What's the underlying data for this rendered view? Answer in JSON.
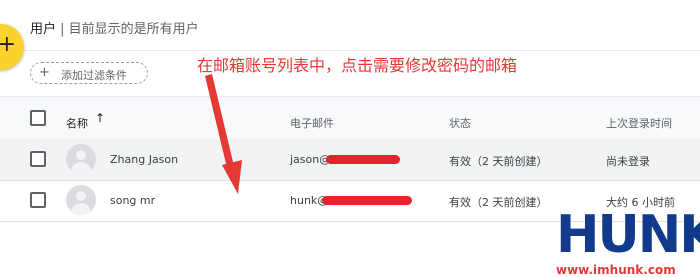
{
  "header": {
    "title": "用户",
    "subtitle": "| 目前显示的是所有用户",
    "fab_symbol": "+"
  },
  "filter": {
    "label": "添加过滤条件",
    "plus": "+"
  },
  "annotation": "在邮箱账号列表中，点击需要修改密码的邮箱",
  "table": {
    "columns": {
      "name": "名称",
      "email": "电子邮件",
      "status": "状态",
      "last_login": "上次登录时间"
    },
    "rows": [
      {
        "name": "Zhang Jason",
        "email": "jason@",
        "status": "有效（2 天前创建）",
        "last_login": "尚未登录"
      },
      {
        "name": "song mr",
        "email": "hunk@",
        "status": "有效（2 天前创建）",
        "last_login": "大约 6 小时前"
      }
    ]
  },
  "watermark": {
    "brand": "HUNK",
    "url": "www.imhunk.com"
  },
  "colors": {
    "fab": "#fbd12c",
    "annotation": "#e53935",
    "redaction": "#e8242b",
    "brand": "#123a8c"
  },
  "icons": [
    "add-icon",
    "sort-arrow-up-icon",
    "avatar-icon",
    "checkbox-icon"
  ]
}
